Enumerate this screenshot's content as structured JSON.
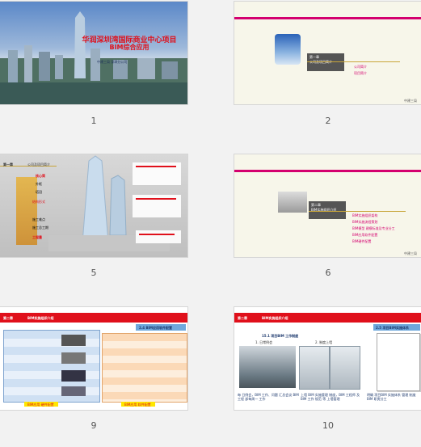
{
  "slides": [
    {
      "number": "1",
      "title_line1": "华润深圳湾国际商业中心项目",
      "title_line2": "BIM综合应用",
      "presenter": "中建三局 深圳分公司"
    },
    {
      "number": "2",
      "chapter": "第一章",
      "chapter_title": "公司及项目简介",
      "bullets": [
        "公司简介",
        "项目简介"
      ],
      "page_mark": "中建三局"
    },
    {
      "number": "5",
      "chapter": "第一章",
      "chapter_title": "公司及项目简介",
      "labels": [
        "核心筒",
        "外框",
        "塔冠",
        "结构形式",
        "施工难点",
        "施工总工期",
        "工程量"
      ],
      "page_mark": "中建三局"
    },
    {
      "number": "6",
      "chapter": "第二章",
      "chapter_title": "BIM实施组织介绍",
      "bullets": [
        "BIM实施组织架构",
        "BIM实施流程策划",
        "BIM模型 建模标准及专业分工",
        "BIM应用软件配置",
        "BIM硬件配置"
      ],
      "page_mark": "中建三局"
    },
    {
      "number": "9",
      "chapter": "第二章",
      "chapter_title": "BIM实施组织介绍",
      "box_title": "2.4 BIM应用软件配置",
      "footer_left": "BIM应用 硬件配置",
      "footer_right": "BIM应用 软件配置"
    },
    {
      "number": "10",
      "chapter": "第二章",
      "chapter_title": "BIM实施组织介绍",
      "box_title": "2.5 项目BIM实施体系",
      "subtitle": "15.1 项目BIM 工作制度",
      "col_titles": [
        "1. 日常例会",
        "2. 制度上墙"
      ],
      "captions": [
        "每 日例会，BIM 工作、问题 汇总会议 BIM 工程 部每周一 工作",
        "上墙 BIM 实施管理 制度，BIM 工程师 及 BIM 工作 规范 等 上墙管理",
        "明确 项目BIM 实施体系 管理 制度 BIM 职责分工"
      ]
    }
  ],
  "colors": {
    "accent_red": "#e0101b",
    "accent_pink": "#d4006f",
    "accent_blue": "#1e5fb4",
    "thumb_bg": "#f2f2f2"
  }
}
